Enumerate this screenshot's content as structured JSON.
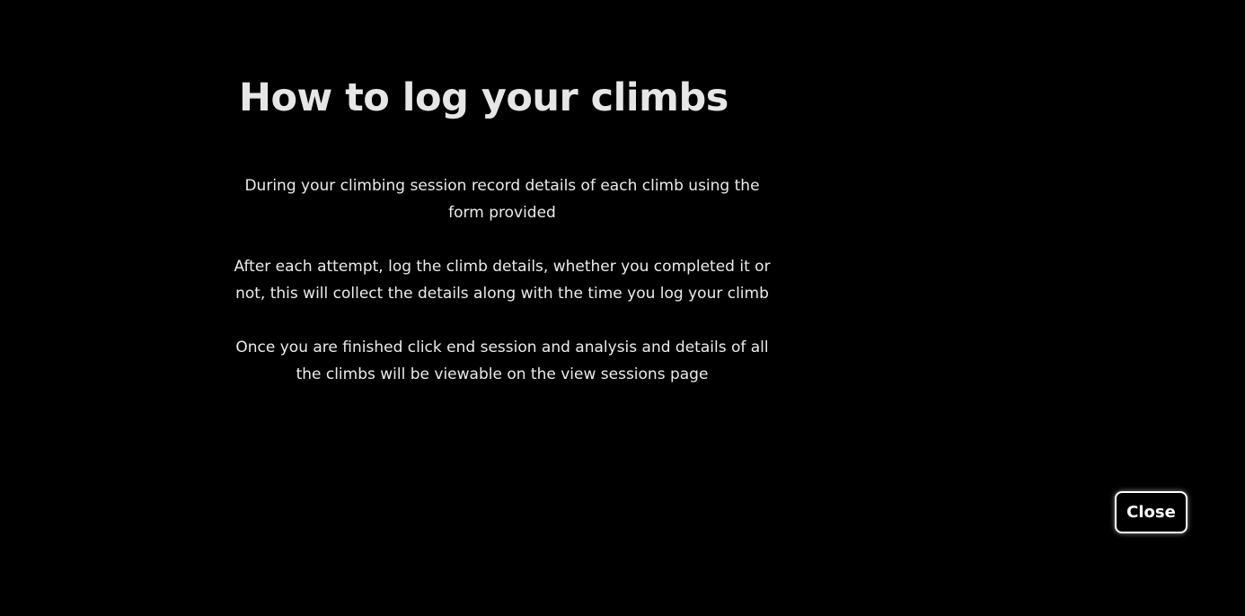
{
  "modal": {
    "title": "How to log your climbs",
    "paragraphs": [
      "During your climbing session record details of each climb using the form provided",
      "After each attempt, log the climb details, whether you completed it or not, this will collect the details along with the time you log your climb",
      "Once you are finished click end session and analysis and details of all the climbs will be viewable on the view sessions page"
    ],
    "close_label": "Close"
  },
  "colors": {
    "background": "#000000",
    "text": "#ececec",
    "button_border": "#ffffff"
  }
}
